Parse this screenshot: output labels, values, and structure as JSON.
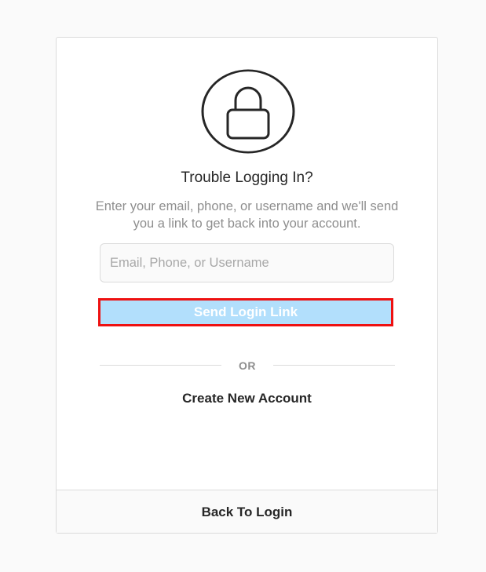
{
  "colors": {
    "page_background": "#fafafa",
    "card_background": "#ffffff",
    "border": "#dbdbdb",
    "button_background": "#b2dffc",
    "highlight_outline": "#ee1111",
    "primary_text": "#262626",
    "secondary_text": "#8e8e8e"
  },
  "lock": {
    "icon": "lock-icon"
  },
  "form": {
    "title": "Trouble Logging In?",
    "description": "Enter your email, phone, or username and we'll send you a link to get back into your account.",
    "input_value": "",
    "input_placeholder": "Email, Phone, or Username",
    "send_button_label": "Send Login Link"
  },
  "divider": {
    "label": "OR"
  },
  "create_account_label": "Create New Account",
  "back_to_login_label": "Back To Login"
}
